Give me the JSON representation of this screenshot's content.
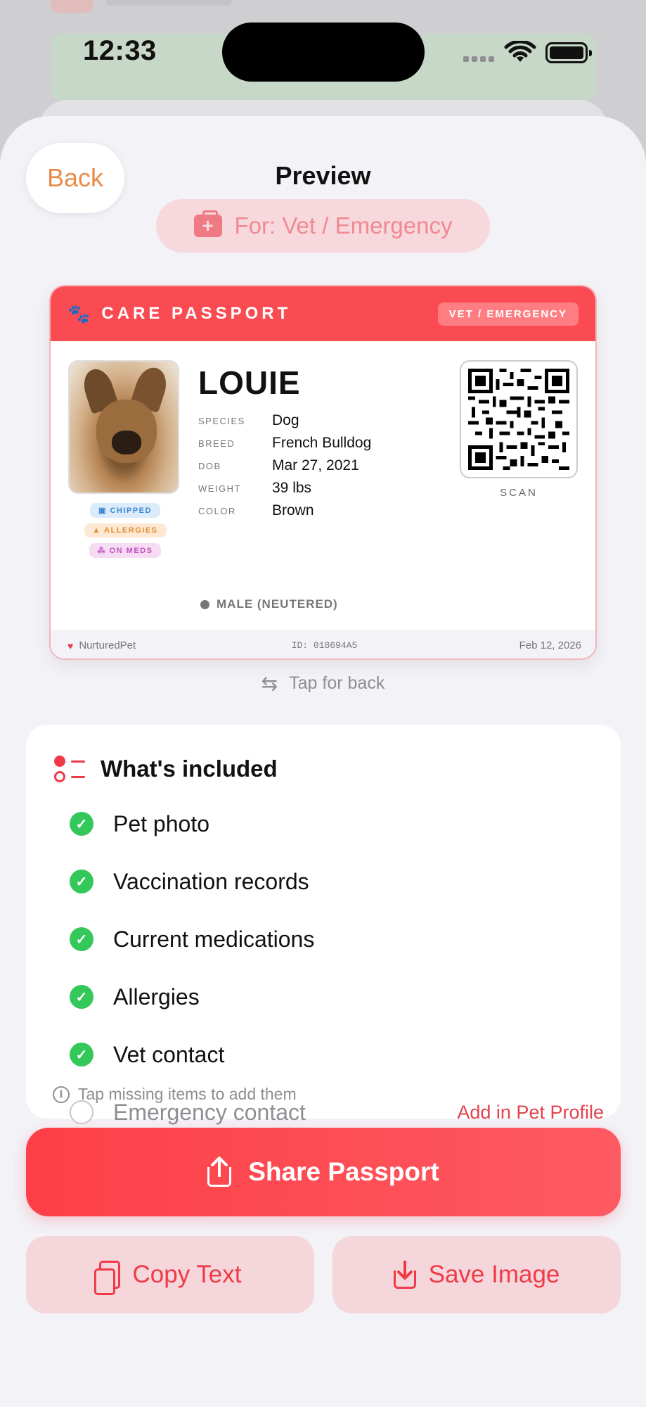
{
  "status_bar": {
    "time": "12:33"
  },
  "header": {
    "back_label": "Back",
    "title": "Preview",
    "for_label": "For: Vet / Emergency"
  },
  "card": {
    "title": "CARE PASSPORT",
    "badge": "VET / EMERGENCY",
    "name": "LOUIE",
    "fields": [
      {
        "key": "SPECIES",
        "value": "Dog"
      },
      {
        "key": "BREED",
        "value": "French Bulldog"
      },
      {
        "key": "DOB",
        "value": "Mar 27, 2021"
      },
      {
        "key": "WEIGHT",
        "value": "39 lbs"
      },
      {
        "key": "COLOR",
        "value": "Brown"
      }
    ],
    "tags": {
      "chipped": "CHIPPED",
      "allergies": "ALLERGIES",
      "meds": "ON MEDS"
    },
    "scan_label": "SCAN",
    "sex": "MALE (NEUTERED)",
    "footer": {
      "brand": "NurturedPet",
      "id": "ID: 018694A5",
      "date": "Feb 12, 2026"
    }
  },
  "tap_back": "Tap for back",
  "included": {
    "title": "What's included",
    "items": [
      {
        "label": "Pet photo",
        "included": true
      },
      {
        "label": "Vaccination records",
        "included": true
      },
      {
        "label": "Current medications",
        "included": true
      },
      {
        "label": "Allergies",
        "included": true
      },
      {
        "label": "Vet contact",
        "included": true
      },
      {
        "label": "Emergency contact",
        "included": false,
        "action": "Add in Pet Profile"
      }
    ],
    "hint": "Tap missing items to add them"
  },
  "actions": {
    "share": "Share Passport",
    "copy": "Copy Text",
    "save": "Save Image"
  },
  "colors": {
    "accent": "#fb4b52",
    "orange": "#e88c4a",
    "check": "#34c759"
  }
}
